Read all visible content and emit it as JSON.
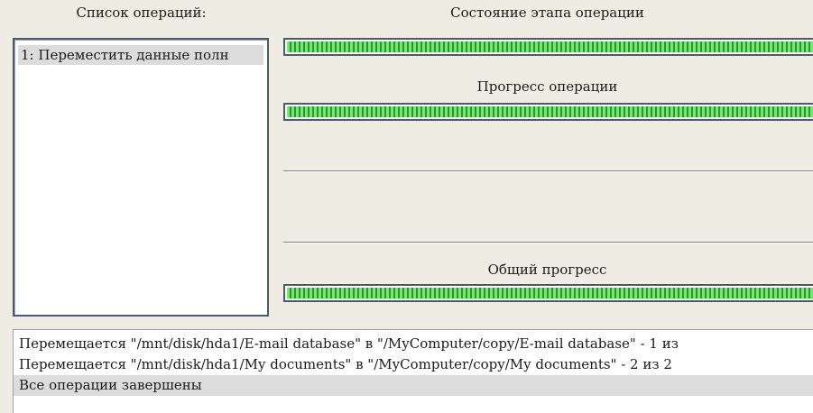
{
  "operations_panel": {
    "heading": "Список операций:",
    "items": [
      {
        "label": "1: Переместить данные полн"
      }
    ]
  },
  "stage_state": {
    "heading": "Состояние этапа операции",
    "progress": 1.0
  },
  "operation_progress": {
    "heading": "Прогресс операции",
    "progress": 1.0
  },
  "overall_progress": {
    "heading": "Общий прогресс",
    "progress": 1.0
  },
  "log": {
    "lines": [
      {
        "text": "Перемещается \"/mnt/disk/hda1/E-mail database\" в \"/MyComputer/copy/E-mail database\" - 1 из",
        "selected": false
      },
      {
        "text": "Перемещается \"/mnt/disk/hda1/My documents\" в \"/MyComputer/copy/My documents\" - 2 из 2",
        "selected": false
      },
      {
        "text": "Все операции завершены",
        "selected": true
      }
    ]
  },
  "colors": {
    "bar_fill": "#23b323",
    "window_bg": "#efece3",
    "selection_bg": "#dcdcdc"
  }
}
